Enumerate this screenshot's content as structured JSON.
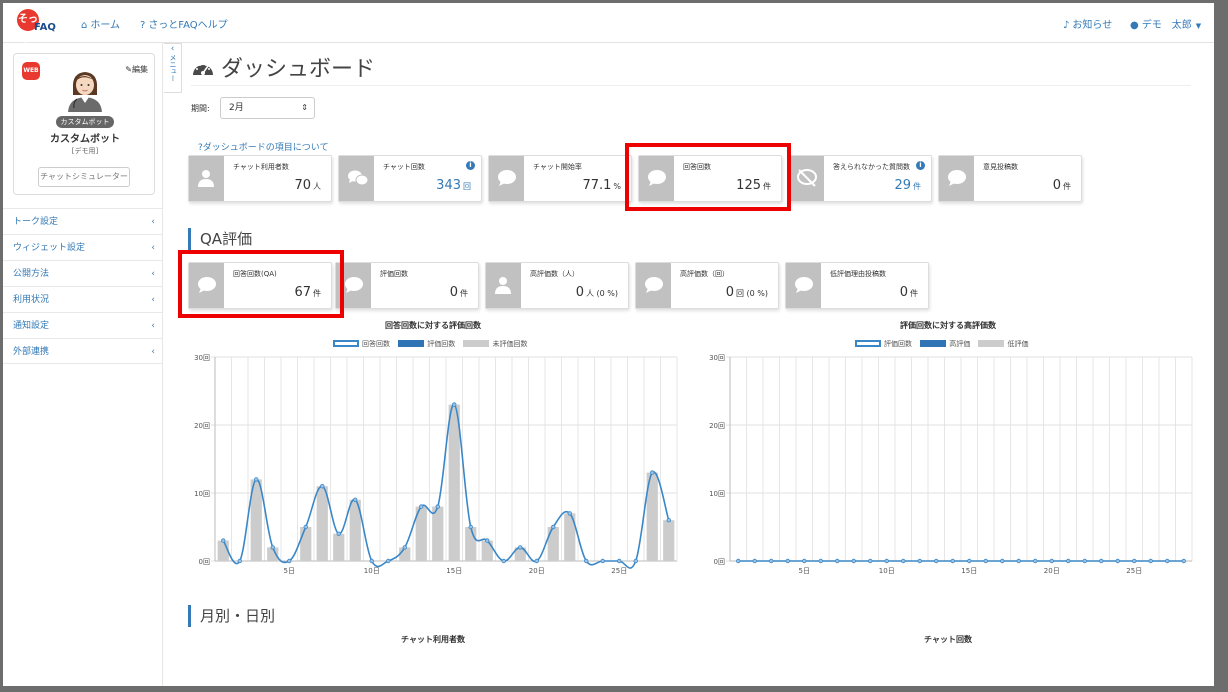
{
  "nav": {
    "logo_mark": "そっと",
    "logo_text": "FAQ",
    "home": "ホーム",
    "help": "さっとFAQヘルプ",
    "notice": "お知らせ",
    "user": "デモ　太郎"
  },
  "sidebar": {
    "web_badge": "WEB",
    "edit": "編集",
    "bot_tag": "カスタムボット",
    "bot_name": "カスタムボット",
    "bot_sub": "[デモ用]",
    "simulator": "チャットシミュレーター",
    "menu_tab": "メニュー",
    "items": [
      {
        "label": "トーク設定"
      },
      {
        "label": "ウィジェット設定"
      },
      {
        "label": "公開方法"
      },
      {
        "label": "利用状況"
      },
      {
        "label": "通知設定"
      },
      {
        "label": "外部連携"
      }
    ]
  },
  "main": {
    "title": "ダッシュボード",
    "period_label": "期間:",
    "period_value": "2月",
    "help_link": "ダッシュボードの項目について",
    "summary_cards": [
      {
        "label": "チャット利用者数",
        "value": "70",
        "unit": "人",
        "info": false,
        "icon": "user-icon"
      },
      {
        "label": "チャット回数",
        "value": "343",
        "unit": "回",
        "info": true,
        "icon": "chats-icon"
      },
      {
        "label": "チャット開始率",
        "value": "77.1",
        "unit": "%",
        "info": false,
        "icon": "chat-icon"
      },
      {
        "label": "回答回数",
        "value": "125",
        "unit": "件",
        "info": false,
        "icon": "chat-icon"
      },
      {
        "label": "答えられなかった質問数",
        "value": "29",
        "unit": "件",
        "info": true,
        "icon": "no-chat-icon"
      },
      {
        "label": "意見投稿数",
        "value": "0",
        "unit": "件",
        "info": false,
        "icon": "chat-icon"
      }
    ],
    "qa_title": "QA評価",
    "qa_cards": [
      {
        "label": "回答回数(QA)",
        "value": "67",
        "unit": "件",
        "icon": "chat-icon"
      },
      {
        "label": "評価回数",
        "value": "0",
        "unit": "件",
        "icon": "chat-icon"
      },
      {
        "label": "高評価数（人）",
        "value": "0",
        "unit": "人 (0 %)",
        "icon": "user-icon"
      },
      {
        "label": "高評価数（回）",
        "value": "0",
        "unit": "回 (0 %)",
        "icon": "chat-icon"
      },
      {
        "label": "低評価理由投稿数",
        "value": "0",
        "unit": "件",
        "icon": "chat-icon"
      }
    ],
    "monthly_title": "月別・日別",
    "bottom_chart_titles": [
      "チャット利用者数",
      "チャット回数"
    ]
  },
  "colors": {
    "accent": "#337ab7",
    "highlight": "#e00000",
    "icon_bg": "#c1c1c1",
    "bar": "#cccccc",
    "line": "#3a87c8"
  },
  "chart_data": [
    {
      "type": "bar",
      "title": "回答回数に対する評価回数",
      "series": [
        {
          "name": "回答回数",
          "kind": "line",
          "values": [
            3,
            0,
            12,
            2,
            0,
            5,
            11,
            4,
            9,
            0,
            0,
            2,
            8,
            8,
            23,
            5,
            3,
            0,
            2,
            0,
            5,
            7,
            0,
            0,
            0,
            0,
            13,
            6
          ]
        },
        {
          "name": "評価回数",
          "kind": "bar",
          "values": [
            0,
            0,
            0,
            0,
            0,
            0,
            0,
            0,
            0,
            0,
            0,
            0,
            0,
            0,
            0,
            0,
            0,
            0,
            0,
            0,
            0,
            0,
            0,
            0,
            0,
            0,
            0,
            0
          ]
        },
        {
          "name": "未評価回数",
          "kind": "bar",
          "values": [
            3,
            0,
            12,
            2,
            0,
            5,
            11,
            4,
            9,
            0,
            0,
            2,
            8,
            8,
            23,
            5,
            3,
            0,
            2,
            0,
            5,
            7,
            0,
            0,
            0,
            0,
            13,
            6
          ]
        }
      ],
      "x": [
        1,
        2,
        3,
        4,
        5,
        6,
        7,
        8,
        9,
        10,
        11,
        12,
        13,
        14,
        15,
        16,
        17,
        18,
        19,
        20,
        21,
        22,
        23,
        24,
        25,
        26,
        27,
        28
      ],
      "xticks": [
        5,
        10,
        15,
        20,
        25
      ],
      "ylim": [
        0,
        30
      ],
      "yticks": [
        0,
        10,
        20,
        30
      ],
      "ytick_labels": [
        "0回",
        "10回",
        "20回",
        "30回"
      ],
      "legend": "top"
    },
    {
      "type": "bar",
      "title": "評価回数に対する高評価数",
      "series": [
        {
          "name": "評価回数",
          "kind": "line",
          "values": [
            0,
            0,
            0,
            0,
            0,
            0,
            0,
            0,
            0,
            0,
            0,
            0,
            0,
            0,
            0,
            0,
            0,
            0,
            0,
            0,
            0,
            0,
            0,
            0,
            0,
            0,
            0,
            0
          ]
        },
        {
          "name": "高評価",
          "kind": "bar",
          "values": [
            0,
            0,
            0,
            0,
            0,
            0,
            0,
            0,
            0,
            0,
            0,
            0,
            0,
            0,
            0,
            0,
            0,
            0,
            0,
            0,
            0,
            0,
            0,
            0,
            0,
            0,
            0,
            0
          ]
        },
        {
          "name": "低評価",
          "kind": "bar",
          "values": [
            0,
            0,
            0,
            0,
            0,
            0,
            0,
            0,
            0,
            0,
            0,
            0,
            0,
            0,
            0,
            0,
            0,
            0,
            0,
            0,
            0,
            0,
            0,
            0,
            0,
            0,
            0,
            0
          ]
        }
      ],
      "x": [
        1,
        2,
        3,
        4,
        5,
        6,
        7,
        8,
        9,
        10,
        11,
        12,
        13,
        14,
        15,
        16,
        17,
        18,
        19,
        20,
        21,
        22,
        23,
        24,
        25,
        26,
        27,
        28
      ],
      "xticks": [
        5,
        10,
        15,
        20,
        25
      ],
      "ylim": [
        0,
        30
      ],
      "yticks": [
        0,
        10,
        20,
        30
      ],
      "ytick_labels": [
        "0回",
        "10回",
        "20回",
        "30回"
      ],
      "legend": "top"
    }
  ]
}
